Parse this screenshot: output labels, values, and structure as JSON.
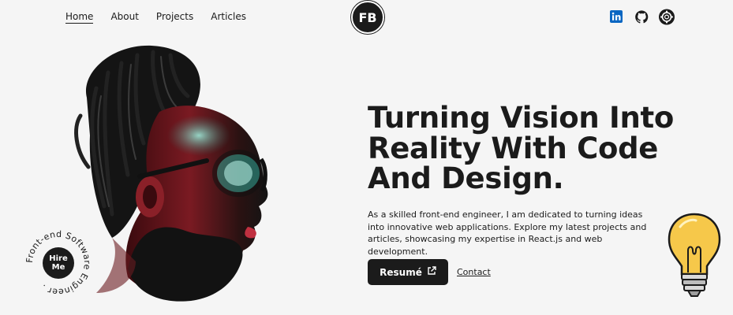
{
  "nav": {
    "links": [
      {
        "label": "Home",
        "active": true
      },
      {
        "label": "About",
        "active": false
      },
      {
        "label": "Projects",
        "active": false
      },
      {
        "label": "Articles",
        "active": false
      }
    ],
    "logo": "FB",
    "socials": [
      "linkedin-icon",
      "github-icon",
      "dribbble-icon"
    ]
  },
  "badge": {
    "button_label": "Hire Me",
    "ring_text": "Front-end Software Engineer . "
  },
  "hero": {
    "headline": "Turning Vision Into Reality With Code And Design.",
    "intro": "As a skilled front-end engineer, I am dedicated to turning ideas into innovative web applications. Explore my latest projects and articles, showcasing my expertise in React.js and web development.",
    "resume_label": "Resumé",
    "contact_label": "Contact"
  },
  "colors": {
    "background": "#f5f5f5",
    "dark": "#1b1b1b",
    "linkedin": "#0a66c2",
    "bulb": "#f6c84a"
  }
}
